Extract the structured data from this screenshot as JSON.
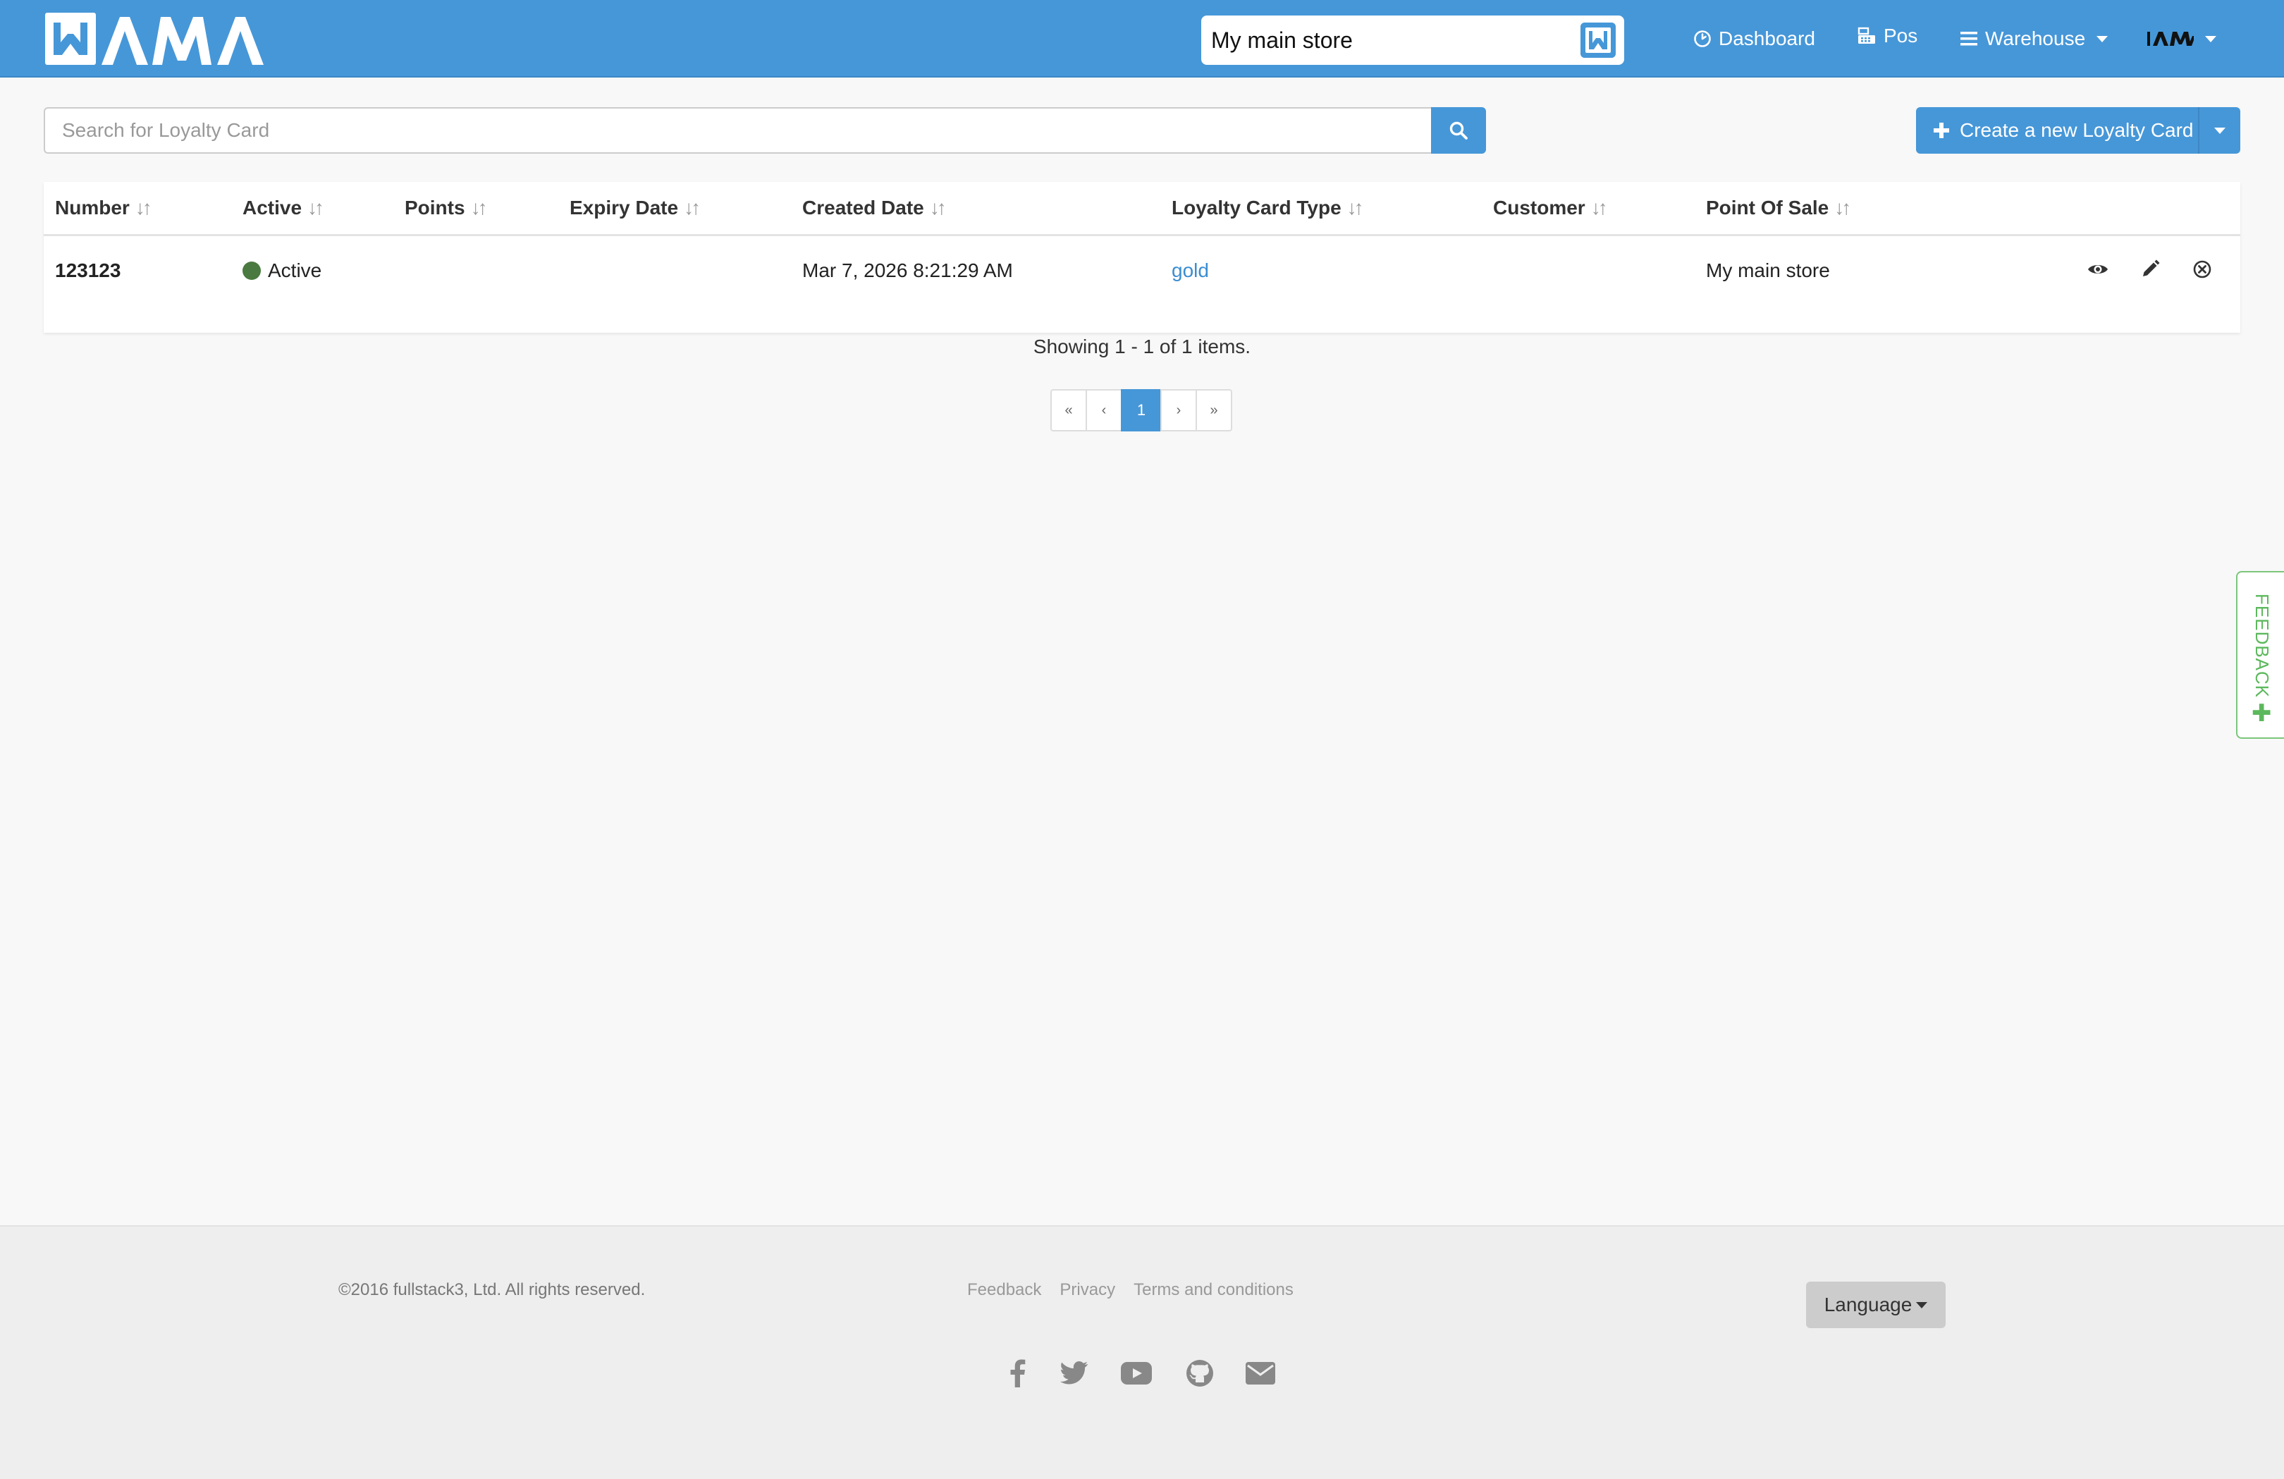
{
  "nav": {
    "store_value": "My main store",
    "items": [
      {
        "label": "Dashboard",
        "icon": "dashboard-icon"
      },
      {
        "label": "Pos",
        "icon": "pos-icon"
      },
      {
        "label": "Warehouse",
        "icon": "menu-icon"
      }
    ],
    "brand_color": "#4697d8"
  },
  "search": {
    "placeholder": "Search for Loyalty Card",
    "create_label": "Create a new Loyalty Card"
  },
  "table": {
    "headers": [
      "Number",
      "Active",
      "Points",
      "Expiry Date",
      "Created Date",
      "Loyalty Card Type",
      "Customer",
      "Point Of Sale"
    ],
    "rows": [
      {
        "number": "123123",
        "active": "Active",
        "points": "",
        "expiry_date": "",
        "created_date": "Mar 7, 2026 8:21:29 AM",
        "loyalty_card_type": "gold",
        "customer": "",
        "point_of_sale": "My main store"
      }
    ],
    "showing": "Showing 1 - 1 of 1 items."
  },
  "pagination": {
    "first": "«",
    "prev": "‹",
    "current": "1",
    "next": "›",
    "last": "»"
  },
  "feedback_tab": {
    "label": "FEEDBACK",
    "color": "#5cb85c"
  },
  "footer": {
    "copyright": "©2016 fullstack3, Ltd. All rights reserved.",
    "links": [
      "Feedback",
      "Privacy",
      "Terms and conditions"
    ],
    "language_label": "Language",
    "social_icons": [
      "facebook-icon",
      "twitter-icon",
      "youtube-icon",
      "github-icon",
      "envelope-icon"
    ]
  }
}
